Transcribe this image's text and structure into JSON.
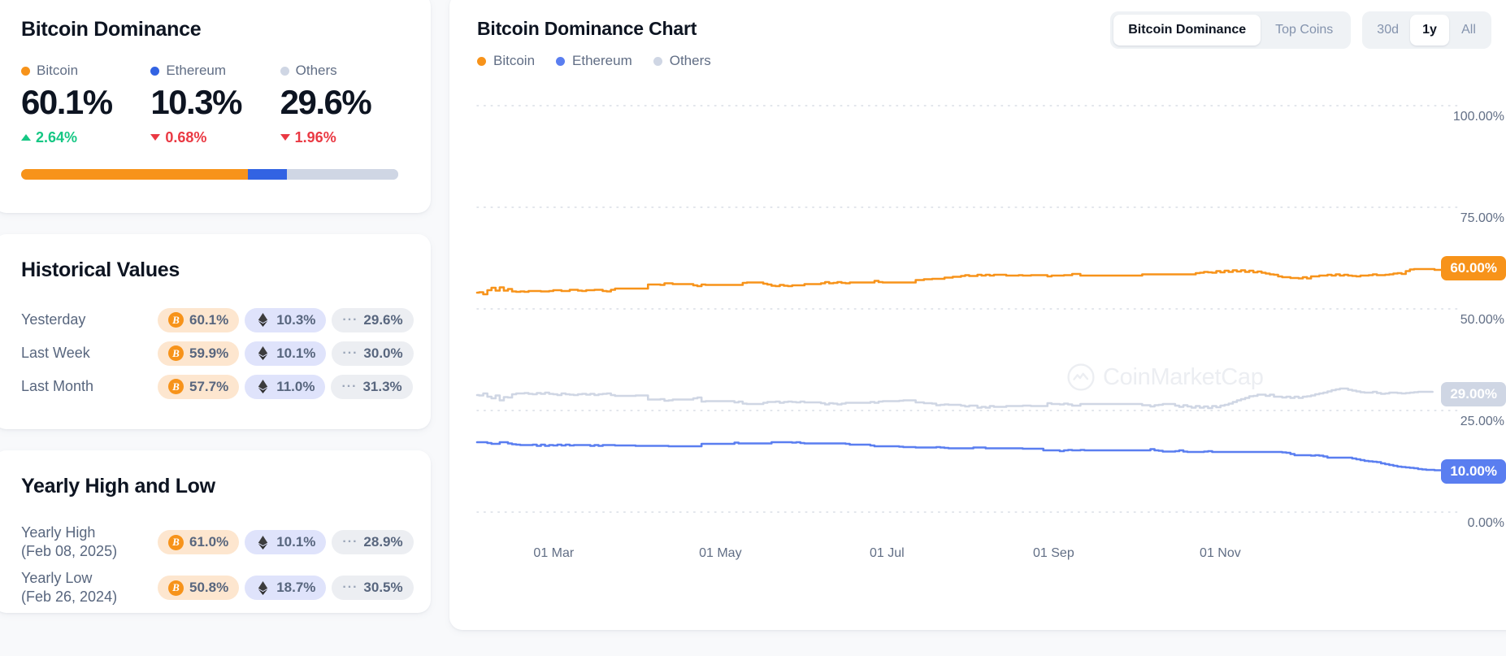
{
  "dominance_card": {
    "title": "Bitcoin Dominance",
    "metrics": [
      {
        "name": "Bitcoin",
        "icon": "orange-dot",
        "color": "#f7931a",
        "value": "60.1%",
        "change": "2.64%",
        "direction": "up",
        "share": 60.1
      },
      {
        "name": "Ethereum",
        "icon": "blue-dot",
        "color": "#3263e3",
        "value": "10.3%",
        "change": "0.68%",
        "direction": "down",
        "share": 10.3
      },
      {
        "name": "Others",
        "icon": "gray-dot",
        "color": "#cfd6e4",
        "value": "29.6%",
        "change": "1.96%",
        "direction": "down",
        "share": 29.6
      }
    ],
    "colors": {
      "positive": "#16c784",
      "negative": "#ea3943",
      "bitcoin": "#f7931a",
      "ethereum": "#3263e3",
      "others": "#cfd6e4"
    }
  },
  "historical_card": {
    "title": "Historical Values",
    "rows": [
      {
        "label": "Yesterday",
        "btc": "60.1%",
        "eth": "10.3%",
        "others": "29.6%"
      },
      {
        "label": "Last Week",
        "btc": "59.9%",
        "eth": "10.1%",
        "others": "30.0%"
      },
      {
        "label": "Last Month",
        "btc": "57.7%",
        "eth": "11.0%",
        "others": "31.3%"
      }
    ]
  },
  "yearly_card": {
    "title": "Yearly High and Low",
    "rows": [
      {
        "label_line1": "Yearly High",
        "label_line2": "(Feb 08, 2025)",
        "btc": "61.0%",
        "eth": "10.1%",
        "others": "28.9%"
      },
      {
        "label_line1": "Yearly Low",
        "label_line2": "(Feb 26, 2024)",
        "btc": "50.8%",
        "eth": "18.7%",
        "others": "30.5%"
      }
    ]
  },
  "chart_card": {
    "title": "Bitcoin Dominance Chart",
    "legend": [
      {
        "label": "Bitcoin",
        "color": "#f7931a"
      },
      {
        "label": "Ethereum",
        "color": "#5a7ef0"
      },
      {
        "label": "Others",
        "color": "#cfd6e4"
      }
    ],
    "view_toggle": {
      "options": [
        "Bitcoin Dominance",
        "Top Coins"
      ],
      "selected": "Bitcoin Dominance"
    },
    "range_toggle": {
      "options": [
        "30d",
        "1y",
        "All"
      ],
      "selected": "1y"
    },
    "watermark": "CoinMarketCap"
  },
  "chart_data": {
    "type": "line",
    "title": "Bitcoin Dominance Chart",
    "xlabel": "",
    "ylabel": "",
    "ylim": [
      0,
      100
    ],
    "grid": true,
    "legend_position": "top-left",
    "y_ticks": [
      "0.00%",
      "25.00%",
      "50.00%",
      "75.00%",
      "100.00%"
    ],
    "y_tick_values": [
      0,
      25,
      50,
      75,
      100
    ],
    "x_ticks": [
      "01 Mar",
      "01 May",
      "01 Jul",
      "01 Sep",
      "01 Nov"
    ],
    "x_tick_positions": [
      0.055,
      0.225,
      0.395,
      0.565,
      0.735
    ],
    "end_labels": [
      {
        "series": "Bitcoin",
        "text": "60.00%",
        "value": 60,
        "bg": "#f7931a",
        "fg": "#ffffff"
      },
      {
        "series": "Others",
        "text": "29.00%",
        "value": 29,
        "bg": "#cfd6e4",
        "fg": "#ffffff"
      },
      {
        "series": "Ethereum",
        "text": "10.00%",
        "value": 10,
        "bg": "#5a7ef0",
        "fg": "#ffffff"
      }
    ],
    "series": [
      {
        "name": "Bitcoin",
        "color": "#f7931a",
        "values": [
          54.0,
          54.1,
          53.6,
          54.6,
          55.2,
          54.5,
          55.3,
          54.5,
          54.9,
          54.3,
          54.2,
          54.3,
          54.2,
          54.4,
          54.4,
          54.4,
          54.3,
          54.3,
          54.4,
          54.6,
          54.6,
          54.4,
          54.4,
          54.7,
          54.7,
          54.5,
          54.4,
          54.6,
          54.6,
          54.7,
          54.7,
          54.4,
          54.3,
          54.7,
          55.0,
          55.0,
          55.0,
          55.0,
          55.0,
          55.0,
          55.0,
          55.0,
          56.0,
          56.0,
          56.0,
          55.9,
          56.3,
          56.3,
          56.1,
          56.1,
          56.1,
          56.1,
          56.1,
          55.8,
          55.6,
          56.0,
          55.9,
          55.9,
          55.9,
          55.9,
          55.9,
          55.9,
          55.9,
          55.9,
          55.9,
          56.4,
          56.5,
          56.5,
          56.5,
          56.5,
          56.2,
          56.0,
          55.7,
          55.6,
          55.9,
          55.7,
          55.6,
          55.8,
          55.8,
          55.8,
          56.1,
          56.1,
          56.1,
          56.1,
          56.3,
          56.6,
          56.3,
          56.4,
          56.6,
          56.4,
          56.3,
          56.5,
          56.5,
          56.5,
          56.5,
          56.5,
          56.5,
          56.9,
          56.6,
          56.5,
          56.5,
          56.5,
          56.5,
          56.5,
          56.5,
          56.5,
          56.5,
          57.1,
          57.1,
          57.3,
          57.3,
          57.4,
          57.4,
          57.4,
          57.7,
          57.7,
          57.9,
          57.9,
          58.1,
          58.3,
          58.1,
          58.1,
          58.4,
          58.2,
          58.4,
          58.2,
          58.4,
          58.4,
          58.4,
          58.2,
          58.2,
          58.2,
          58.3,
          58.2,
          58.2,
          58.3,
          58.3,
          58.3,
          58.3,
          58.0,
          58.2,
          58.2,
          58.2,
          58.3,
          58.3,
          58.6,
          58.6,
          58.2,
          58.2,
          58.2,
          58.2,
          58.2,
          58.2,
          58.2,
          58.2,
          58.2,
          58.2,
          58.2,
          58.2,
          58.2,
          58.2,
          58.2,
          58.5,
          58.5,
          58.5,
          58.5,
          58.5,
          58.5,
          58.5,
          58.5,
          58.5,
          58.5,
          58.5,
          58.5,
          58.5,
          58.8,
          58.9,
          59.1,
          59.0,
          58.9,
          59.3,
          59.0,
          59.4,
          59.1,
          59.5,
          59.2,
          59.5,
          59.1,
          59.4,
          59.0,
          59.2,
          58.9,
          58.7,
          58.5,
          58.4,
          58.0,
          57.8,
          57.8,
          57.6,
          57.6,
          57.5,
          57.8,
          57.5,
          58.0,
          58.0,
          58.2,
          58.2,
          58.4,
          58.2,
          58.5,
          58.2,
          58.4,
          58.2,
          58.1,
          58.0,
          58.2,
          58.2,
          58.3,
          58.5,
          58.3,
          58.3,
          58.4,
          58.5,
          58.7,
          58.8,
          58.6,
          59.3,
          59.7,
          59.8,
          59.8,
          59.8,
          59.8,
          59.8,
          59.6,
          59.6,
          59.9,
          60.0,
          60.0,
          60.1
        ]
      },
      {
        "name": "Ethereum",
        "color": "#5a7ef0",
        "values": [
          17.2,
          17.2,
          17.2,
          17.0,
          16.8,
          16.8,
          17.2,
          17.2,
          16.9,
          16.7,
          16.6,
          16.5,
          16.5,
          16.5,
          16.6,
          16.3,
          16.6,
          16.3,
          16.5,
          16.4,
          16.6,
          16.4,
          16.6,
          16.4,
          16.5,
          16.5,
          16.5,
          16.5,
          16.3,
          16.5,
          16.3,
          16.5,
          16.5,
          16.5,
          16.4,
          16.4,
          16.4,
          16.4,
          16.4,
          16.3,
          16.3,
          16.3,
          16.3,
          16.3,
          16.3,
          16.3,
          16.3,
          16.2,
          16.2,
          16.2,
          16.2,
          16.2,
          16.2,
          16.2,
          16.2,
          16.8,
          16.8,
          16.8,
          16.8,
          16.8,
          16.8,
          16.8,
          16.8,
          17.1,
          16.9,
          16.9,
          16.9,
          16.9,
          16.9,
          16.9,
          16.9,
          16.9,
          17.2,
          17.2,
          17.2,
          17.2,
          17.2,
          17.1,
          17.2,
          17.0,
          16.9,
          16.9,
          16.9,
          16.9,
          16.9,
          16.9,
          16.9,
          16.9,
          16.9,
          16.9,
          16.8,
          16.6,
          16.6,
          16.6,
          16.6,
          16.6,
          16.4,
          16.2,
          16.2,
          16.2,
          16.2,
          16.2,
          16.2,
          16.1,
          16.0,
          16.0,
          16.0,
          15.9,
          15.9,
          15.9,
          15.9,
          15.9,
          16.0,
          15.9,
          15.8,
          15.7,
          15.7,
          15.7,
          15.7,
          15.7,
          15.7,
          15.9,
          15.9,
          15.9,
          15.7,
          15.7,
          15.7,
          15.7,
          15.7,
          15.7,
          15.7,
          15.7,
          15.7,
          15.6,
          15.6,
          15.6,
          15.6,
          15.6,
          15.2,
          15.2,
          15.2,
          15.2,
          15.0,
          15.2,
          15.3,
          15.2,
          15.2,
          15.3,
          15.2,
          15.2,
          15.2,
          15.2,
          15.2,
          15.2,
          15.2,
          15.2,
          15.2,
          15.2,
          15.2,
          15.2,
          15.2,
          15.2,
          15.2,
          15.2,
          15.5,
          15.2,
          15.1,
          14.9,
          14.9,
          14.9,
          15.0,
          15.2,
          14.9,
          14.8,
          14.8,
          14.8,
          14.8,
          14.9,
          15.0,
          14.8,
          14.8,
          14.8,
          14.8,
          14.8,
          14.8,
          14.8,
          14.8,
          14.8,
          14.8,
          14.8,
          14.8,
          14.8,
          14.8,
          14.8,
          14.8,
          14.8,
          14.7,
          14.6,
          14.3,
          14.0,
          14.0,
          14.0,
          14.0,
          13.9,
          14.0,
          13.9,
          13.7,
          13.4,
          13.4,
          13.4,
          13.4,
          13.4,
          13.4,
          13.2,
          13.0,
          12.8,
          12.6,
          12.5,
          12.4,
          12.3,
          12.0,
          11.8,
          11.6,
          11.4,
          11.2,
          11.1,
          11.0,
          10.9,
          10.8,
          10.6,
          10.5,
          10.4,
          10.4,
          10.3,
          10.3,
          10.3,
          10.3,
          10.3
        ]
      },
      {
        "name": "Others",
        "color": "#cfd6e4",
        "values": [
          28.8,
          28.7,
          29.2,
          28.4,
          28.0,
          28.7,
          27.5,
          28.3,
          28.2,
          29.0,
          29.2,
          29.2,
          29.3,
          29.1,
          29.0,
          29.3,
          29.1,
          29.4,
          29.1,
          29.0,
          28.8,
          29.2,
          29.0,
          28.9,
          28.8,
          29.0,
          29.1,
          28.9,
          29.1,
          28.8,
          29.0,
          29.1,
          29.2,
          28.8,
          28.6,
          28.6,
          28.6,
          28.6,
          28.6,
          28.7,
          28.7,
          28.7,
          27.7,
          27.7,
          27.7,
          27.8,
          27.4,
          27.5,
          27.7,
          27.7,
          27.7,
          27.7,
          27.7,
          28.0,
          28.2,
          27.2,
          27.3,
          27.3,
          27.3,
          27.3,
          27.3,
          27.3,
          27.3,
          27.0,
          27.2,
          26.7,
          26.6,
          26.6,
          26.6,
          26.6,
          26.9,
          27.1,
          27.1,
          27.2,
          26.9,
          27.1,
          27.2,
          27.1,
          27.0,
          27.2,
          27.0,
          27.0,
          27.0,
          27.0,
          26.8,
          26.5,
          26.8,
          26.7,
          26.5,
          26.7,
          26.9,
          26.9,
          26.9,
          26.9,
          26.9,
          26.9,
          27.1,
          26.9,
          27.2,
          27.3,
          27.3,
          27.3,
          27.3,
          27.4,
          27.5,
          27.5,
          27.5,
          27.0,
          27.0,
          26.8,
          26.8,
          26.7,
          26.3,
          26.4,
          26.5,
          26.4,
          26.4,
          26.4,
          26.2,
          26.0,
          26.2,
          26.2,
          25.7,
          25.9,
          25.7,
          26.1,
          25.9,
          25.9,
          25.9,
          26.1,
          26.1,
          26.1,
          26.1,
          26.2,
          26.2,
          26.1,
          26.1,
          26.1,
          26.1,
          26.8,
          26.6,
          26.6,
          26.5,
          26.7,
          26.5,
          26.2,
          26.2,
          26.6,
          26.6,
          26.6,
          26.6,
          26.6,
          26.6,
          26.6,
          26.6,
          26.6,
          26.6,
          26.6,
          26.6,
          26.6,
          26.6,
          26.6,
          26.3,
          26.3,
          26.0,
          26.3,
          26.4,
          26.6,
          26.6,
          26.6,
          26.2,
          25.9,
          26.3,
          26.0,
          25.7,
          26.1,
          25.7,
          26.0,
          25.6,
          26.1,
          25.8,
          26.2,
          26.4,
          26.7,
          27.1,
          27.5,
          27.8,
          28.1,
          28.5,
          28.6,
          28.9,
          28.9,
          28.6,
          28.9,
          28.4,
          28.4,
          28.2,
          28.4,
          28.1,
          28.4,
          28.1,
          28.4,
          28.5,
          28.7,
          29.0,
          29.2,
          29.4,
          29.7,
          30.0,
          30.2,
          30.4,
          30.4,
          30.1,
          29.9,
          29.7,
          29.5,
          29.4,
          29.4,
          29.6,
          29.3,
          29.1,
          29.2,
          29.4,
          29.4,
          29.3,
          29.2,
          29.3,
          29.4,
          29.5,
          29.6,
          29.6,
          29.6,
          29.6
        ]
      }
    ]
  }
}
